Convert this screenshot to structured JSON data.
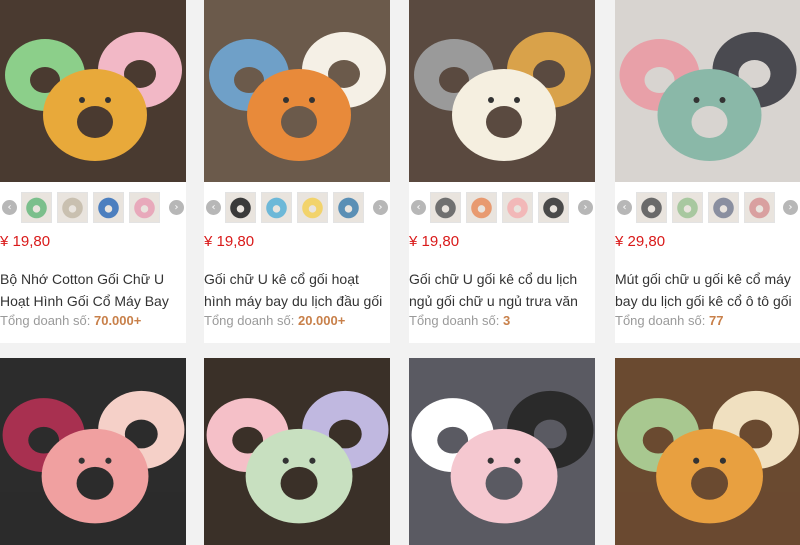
{
  "products": [
    {
      "price": "¥ 19,80",
      "title": "Bộ Nhớ Cotton Gối Chữ U Hoạt Hình Gối Cổ Máy Bay Du Lịch",
      "sales_label": "Tổng doanh số:",
      "sales_value": "70.000+",
      "thumb_colors": [
        "#7bbf8c",
        "#c9c0b0",
        "#4c7fbf",
        "#e8a9bb"
      ],
      "photo_colors": {
        "bg": "#4a3a30",
        "main": "#e8a93a",
        "accent": "#8ccf8a",
        "accent2": "#f2b8c6"
      }
    },
    {
      "price": "¥ 19,80",
      "title": "Gối chữ U kê cổ gối hoạt hình máy bay du lịch đầu gối cổ gối",
      "sales_label": "Tổng doanh số:",
      "sales_value": "20.000+",
      "thumb_colors": [
        "#3a3a3a",
        "#6db8d8",
        "#f2d36b",
        "#5a8fb5"
      ],
      "photo_colors": {
        "bg": "#6b5a4b",
        "main": "#e88a3a",
        "accent": "#6fa0c8",
        "accent2": "#f5f0e6"
      }
    },
    {
      "price": "¥ 19,80",
      "title": "Gối chữ U gối kê cổ du lịch ngủ gối chữ u ngủ trưa văn phòng",
      "sales_label": "Tổng doanh số:",
      "sales_value": "3",
      "thumb_colors": [
        "#707070",
        "#e89a70",
        "#f2b8b8",
        "#4a4a4a"
      ],
      "photo_colors": {
        "bg": "#5a4a40",
        "main": "#f5efe0",
        "accent": "#9a9a9a",
        "accent2": "#d9a24a"
      }
    },
    {
      "price": "¥ 29,80",
      "title": "Mút gối chữ u gối kê cổ máy bay du lịch gối kê cổ ô tô gối",
      "sales_label": "Tổng doanh số:",
      "sales_value": "77",
      "thumb_colors": [
        "#6a6a6a",
        "#a8c8a0",
        "#8a8fa0",
        "#d9a0a0"
      ],
      "photo_colors": {
        "bg": "#d8d4d0",
        "main": "#8ab8a8",
        "accent": "#e8a0a8",
        "accent2": "#4a4a50"
      }
    },
    {
      "photo_colors": {
        "bg": "#2c2c2c",
        "main": "#f0a0a0",
        "accent": "#a83050",
        "accent2": "#f5d0c8"
      }
    },
    {
      "photo_colors": {
        "bg": "#3a3028",
        "main": "#c8e0c0",
        "accent": "#f5c0c8",
        "accent2": "#c0b8e0"
      }
    },
    {
      "photo_colors": {
        "bg": "#5a5a62",
        "main": "#f5c8d0",
        "accent": "#ffffff",
        "accent2": "#2a2a2a"
      }
    },
    {
      "photo_colors": {
        "bg": "#6a4a30",
        "main": "#e8a040",
        "accent": "#a8c890",
        "accent2": "#f0e0c0"
      }
    }
  ]
}
